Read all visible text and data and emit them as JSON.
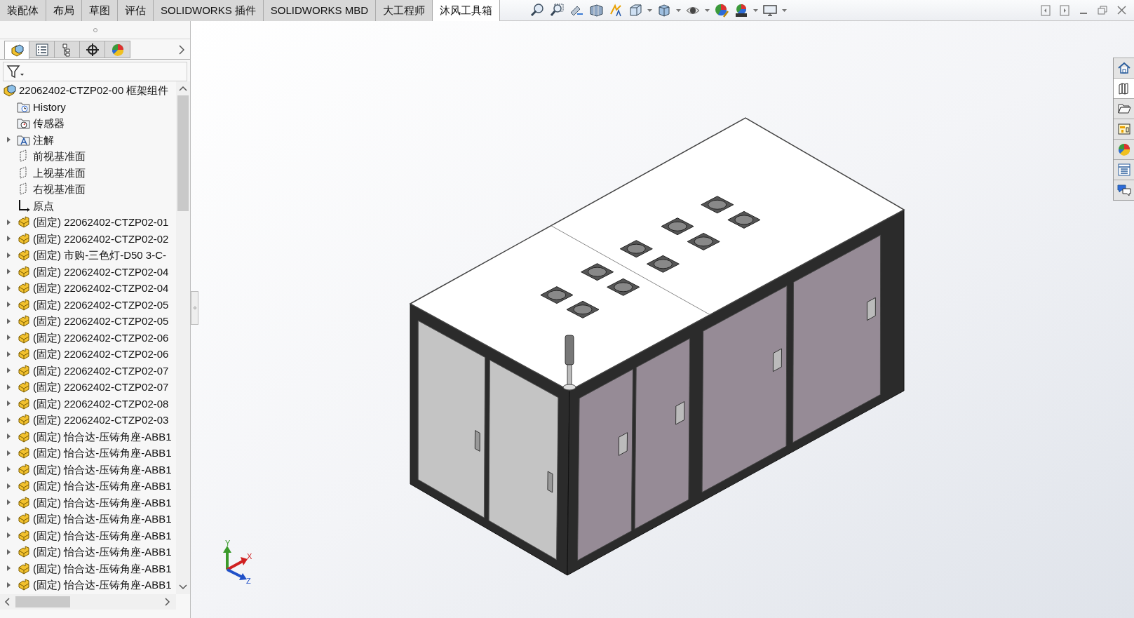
{
  "command_tabs": [
    {
      "label": "装配体",
      "selected": false
    },
    {
      "label": "布局",
      "selected": false
    },
    {
      "label": "草图",
      "selected": false
    },
    {
      "label": "评估",
      "selected": false
    },
    {
      "label": "SOLIDWORKS 插件",
      "selected": false
    },
    {
      "label": "SOLIDWORKS MBD",
      "selected": false
    },
    {
      "label": "大工程师",
      "selected": false
    },
    {
      "label": "沐风工具箱",
      "selected": true
    }
  ],
  "panel_tabs": [
    {
      "kind": "feature-tree",
      "selected": true
    },
    {
      "kind": "property",
      "selected": false
    },
    {
      "kind": "config",
      "selected": false
    },
    {
      "kind": "dim",
      "selected": false
    },
    {
      "kind": "display",
      "selected": false
    }
  ],
  "tree": {
    "root": "22062402-CTZP02-00 框架组件",
    "items": [
      {
        "kind": "history",
        "label": "History",
        "expandable": false
      },
      {
        "kind": "sensor",
        "label": "传感器",
        "expandable": false
      },
      {
        "kind": "annotation",
        "label": "注解",
        "expandable": true
      },
      {
        "kind": "plane",
        "label": "前视基准面",
        "expandable": false
      },
      {
        "kind": "plane",
        "label": "上视基准面",
        "expandable": false
      },
      {
        "kind": "plane",
        "label": "右视基准面",
        "expandable": false
      },
      {
        "kind": "origin",
        "label": "原点",
        "expandable": false
      },
      {
        "kind": "part",
        "label": "(固定) 22062402-CTZP02-01",
        "expandable": true
      },
      {
        "kind": "part",
        "label": "(固定) 22062402-CTZP02-02",
        "expandable": true
      },
      {
        "kind": "part",
        "label": "(固定) 市购-三色灯-D50 3-C-",
        "expandable": true
      },
      {
        "kind": "part",
        "label": "(固定) 22062402-CTZP02-04",
        "expandable": true
      },
      {
        "kind": "part",
        "label": "(固定) 22062402-CTZP02-04",
        "expandable": true
      },
      {
        "kind": "part",
        "label": "(固定) 22062402-CTZP02-05",
        "expandable": true
      },
      {
        "kind": "part",
        "label": "(固定) 22062402-CTZP02-05",
        "expandable": true
      },
      {
        "kind": "part",
        "label": "(固定) 22062402-CTZP02-06",
        "expandable": true
      },
      {
        "kind": "part",
        "label": "(固定) 22062402-CTZP02-06",
        "expandable": true
      },
      {
        "kind": "part",
        "label": "(固定) 22062402-CTZP02-07",
        "expandable": true
      },
      {
        "kind": "part",
        "label": "(固定) 22062402-CTZP02-07",
        "expandable": true
      },
      {
        "kind": "part",
        "label": "(固定) 22062402-CTZP02-08",
        "expandable": true
      },
      {
        "kind": "part",
        "label": "(固定) 22062402-CTZP02-03",
        "expandable": true
      },
      {
        "kind": "part",
        "label": "(固定) 怡合达-压铸角座-ABB1",
        "expandable": true
      },
      {
        "kind": "part",
        "label": "(固定) 怡合达-压铸角座-ABB1",
        "expandable": true
      },
      {
        "kind": "part",
        "label": "(固定) 怡合达-压铸角座-ABB1",
        "expandable": true
      },
      {
        "kind": "part",
        "label": "(固定) 怡合达-压铸角座-ABB1",
        "expandable": true
      },
      {
        "kind": "part",
        "label": "(固定) 怡合达-压铸角座-ABB1",
        "expandable": true
      },
      {
        "kind": "part",
        "label": "(固定) 怡合达-压铸角座-ABB1",
        "expandable": true
      },
      {
        "kind": "part",
        "label": "(固定) 怡合达-压铸角座-ABB1",
        "expandable": true
      },
      {
        "kind": "part",
        "label": "(固定) 怡合达-压铸角座-ABB1",
        "expandable": true
      },
      {
        "kind": "part",
        "label": "(固定) 怡合达-压铸角座-ABB1",
        "expandable": true
      },
      {
        "kind": "part",
        "label": "(固定) 怡合达-压铸角座-ABB1",
        "expandable": true
      }
    ]
  },
  "triad": {
    "x": "X",
    "y": "Y",
    "z": "Z"
  },
  "task_pane": [
    {
      "kind": "home",
      "selected": false
    },
    {
      "kind": "library",
      "selected": true
    },
    {
      "kind": "folder",
      "selected": false
    },
    {
      "kind": "palette",
      "selected": false
    },
    {
      "kind": "appearance",
      "selected": false
    },
    {
      "kind": "properties",
      "selected": false
    },
    {
      "kind": "forum",
      "selected": false
    }
  ]
}
